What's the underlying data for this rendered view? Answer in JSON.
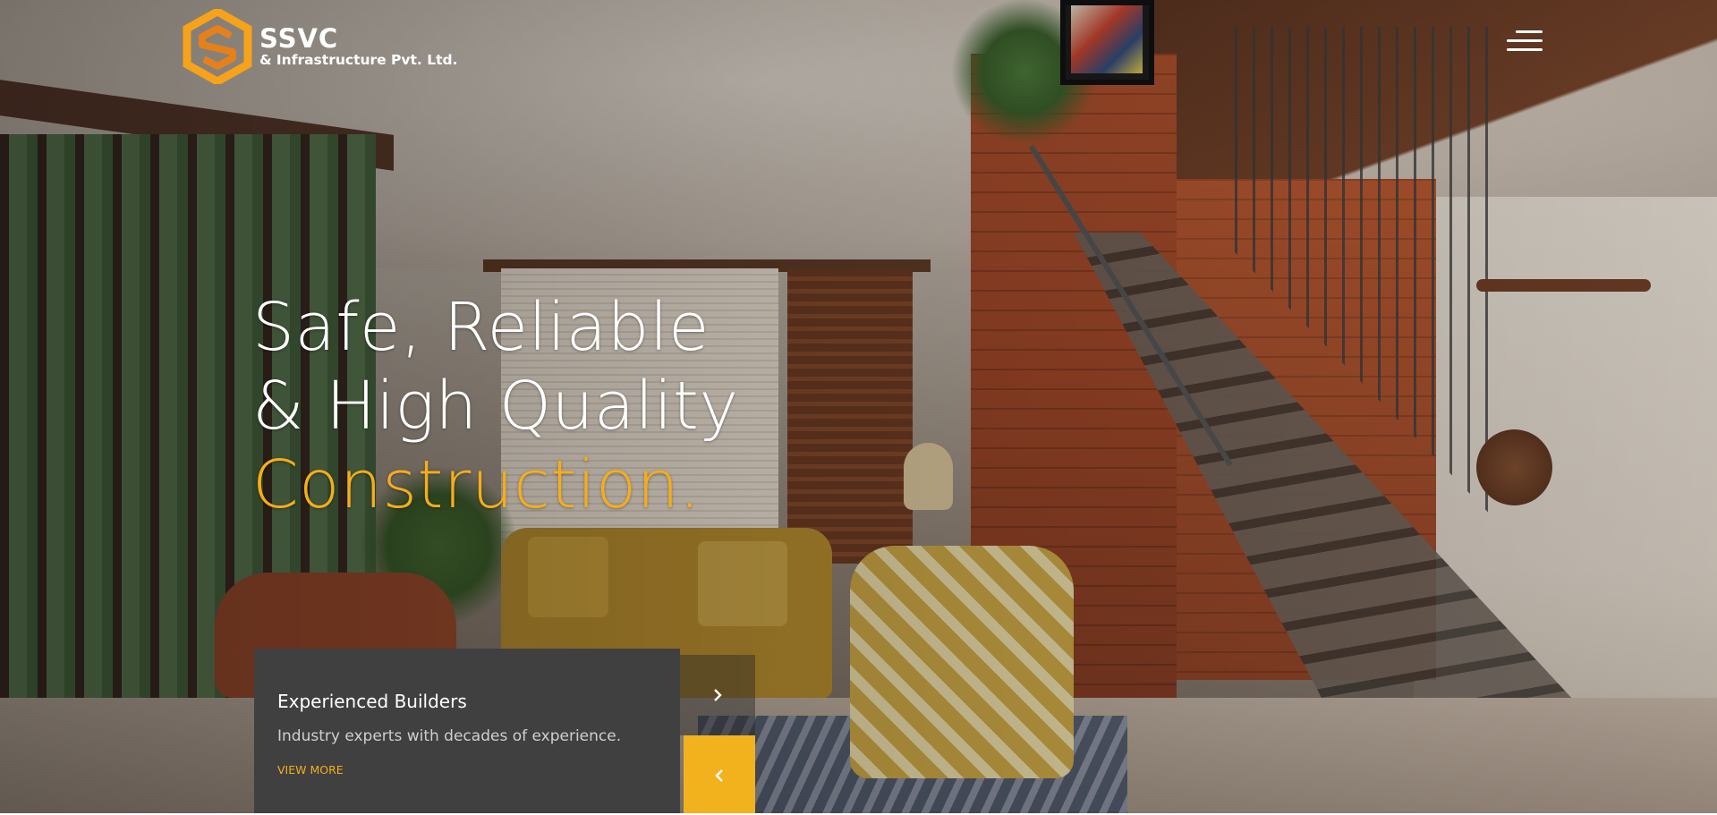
{
  "brand": {
    "name": "SSVC",
    "subtitle": "& Infrastructure Pvt. Ltd.",
    "accent_color": "#f6ad1b",
    "logo_colors": [
      "#f6a21b",
      "#e6801a"
    ]
  },
  "header": {
    "menu_icon": "hamburger-menu-icon"
  },
  "hero": {
    "headline_line1": "Safe, Reliable",
    "headline_line2": "& High Quality",
    "headline_line3": "Construction."
  },
  "slide": {
    "title": "Experienced Builders",
    "text": "Industry experts with decades of experience.",
    "link_label": "VIEW MORE",
    "card_color": "#404040"
  },
  "slider_controls": {
    "next_icon": "chevron-right-icon",
    "prev_icon": "chevron-left-icon",
    "prev_color": "#f1b21d"
  }
}
